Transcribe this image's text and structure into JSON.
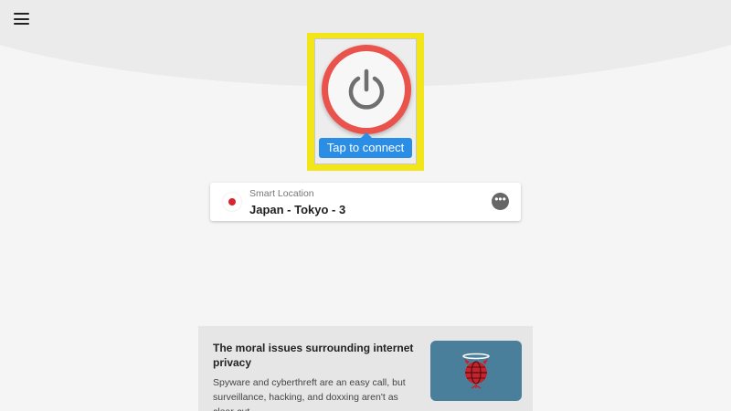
{
  "menu": {
    "icon": "hamburger-menu-icon"
  },
  "connect": {
    "icon": "power-icon",
    "label": "Tap to connect"
  },
  "location": {
    "type_label": "Smart Location",
    "name": "Japan - Tokyo - 3",
    "flag": "japan-flag-icon",
    "more_icon": "more-options-icon"
  },
  "article": {
    "title": "The moral issues surrounding internet privacy",
    "description": "Spyware and cyberthreft are an easy call, but surveillance, hacking, and doxxing aren't as clear-cut.",
    "thumbnail_icon": "globe-devil-icon"
  },
  "colors": {
    "background": "#f5f5f5",
    "highlight": "#f2e51a",
    "power_ring": "#e9534b",
    "accent_blue": "#2b8ee6",
    "thumb_bg": "#4a7f9c",
    "flag_red": "#d7262e"
  }
}
